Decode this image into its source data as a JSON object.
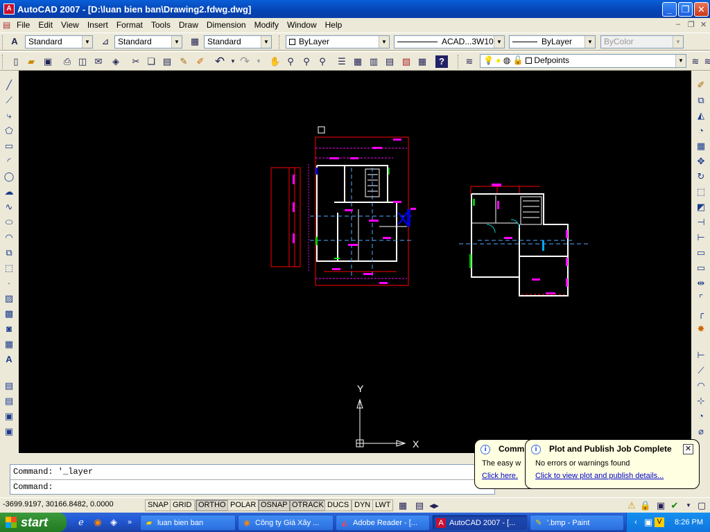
{
  "window": {
    "title": "AutoCAD 2007 - [D:\\luan bien ban\\Drawing2.fdwg.dwg]"
  },
  "menu": [
    "File",
    "Edit",
    "View",
    "Insert",
    "Format",
    "Tools",
    "Draw",
    "Dimension",
    "Modify",
    "Window",
    "Help"
  ],
  "styles_toolbar": {
    "text_style": "Standard",
    "dim_style": "Standard",
    "table_style": "Standard",
    "color": "ByLayer",
    "linetype": "ACAD...3W100",
    "lineweight": "ByLayer",
    "plot_style": "ByColor"
  },
  "layers_toolbar": {
    "current_layer": "Defpoints"
  },
  "canvas": {
    "ucs_y": "Y",
    "ucs_x": "X"
  },
  "command_line": {
    "history": "Command: '_layer",
    "prompt": "Command:"
  },
  "status_bar": {
    "coords": "-3699.9197, 30166.8482, 0.0000",
    "buttons": [
      "SNAP",
      "GRID",
      "ORTHO",
      "POLAR",
      "OSNAP",
      "OTRACK",
      "DUCS",
      "DYN",
      "LWT"
    ]
  },
  "balloons": {
    "back": {
      "title": "Commu",
      "body": "The easy w",
      "link": "Click here."
    },
    "front": {
      "title": "Plot and Publish Job Complete",
      "body": "No errors or warnings found",
      "link": "Click to view plot and publish details..."
    }
  },
  "taskbar": {
    "start": "start",
    "tasks": [
      "luan bien ban",
      "Công ty Giá Xây ...",
      "Adobe Reader - [...",
      "AutoCAD 2007 - [...",
      "'.bmp - Paint"
    ],
    "clock": "8:26 PM"
  },
  "colors": {
    "title_blue": "#0a5fd8",
    "canvas": "#000000",
    "dim_red": "#ff0000",
    "dim_magenta": "#ff00ff",
    "wall_white": "#ffffff",
    "taskbar": "#245edb",
    "start_green": "#2e8a2e"
  }
}
